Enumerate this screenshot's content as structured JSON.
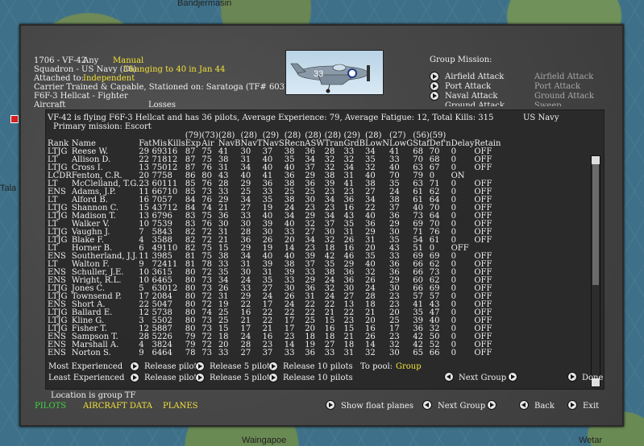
{
  "map": {
    "labels": [
      "Bandjermasin",
      "Waingapoe",
      "Wetar",
      "Tala"
    ]
  },
  "header": {
    "squadron_id": "1706 - VF-42",
    "any": "Any",
    "manual": "Manual",
    "squadron_line": "Squadron - US Navy (36)",
    "change_note": "Changing to 40 in Jan 44",
    "attached_label": "Attached to:",
    "attached_value": "Independent",
    "carrier_line": "Carrier Trained & Capable, Stationed on: Saratoga (TF# 603)",
    "aircraft_type": "F6F-3 Hellcat - Fighter",
    "aircraft_cut": "Aircraft",
    "losses_cut": "Losses",
    "plane_number": "33"
  },
  "group_mission": {
    "title": "Group Mission:",
    "options_left": [
      "Airfield Attack",
      "Port Attack",
      "Naval Attack",
      "Ground Attack"
    ],
    "options_right": [
      "Airfield Attack",
      "Port Attack",
      "Ground Attack",
      "Sweep"
    ]
  },
  "roster": {
    "summary": "VF-42 is flying F6F-3 Hellcat and has 36 pilots,  Average Experience: 79,  Average Fatigue: 12,  Total Kills: 315",
    "service": "US Navy",
    "primary_mission": "Primary mission: Escort",
    "averages": [
      "",
      "",
      "",
      "",
      "",
      "(79)",
      "(73)",
      "(28)",
      "(28)",
      "(29)",
      "(28)",
      "(28)",
      "(28)",
      "(29)",
      "(28)",
      "(27)",
      "(56)",
      "(59)",
      "",
      ""
    ],
    "headers": [
      "Rank",
      "Name",
      "Fat",
      "Mis",
      "Kills",
      "Exp",
      "Air",
      "NavB",
      "NavT",
      "NavS",
      "Recn",
      "ASW",
      "Tran",
      "GrdB",
      "LowN",
      "LowG",
      "Staf",
      "Def'n",
      "Delay",
      "Retain"
    ],
    "rows": [
      [
        "LTJG",
        "Reese W.",
        "29",
        "693",
        "16",
        "87",
        "75",
        "41",
        "30",
        "37",
        "38",
        "36",
        "28",
        "33",
        "34",
        "41",
        "68",
        "70",
        "0",
        "OFF"
      ],
      [
        "LT",
        "Allison D.",
        "22",
        "718",
        "12",
        "87",
        "75",
        "38",
        "31",
        "40",
        "35",
        "34",
        "32",
        "32",
        "35",
        "33",
        "70",
        "68",
        "0",
        "OFF"
      ],
      [
        "LTJG",
        "Cross I.",
        "13",
        "750",
        "12",
        "87",
        "76",
        "31",
        "34",
        "40",
        "40",
        "37",
        "32",
        "34",
        "32",
        "40",
        "63",
        "67",
        "0",
        "OFF"
      ],
      [
        "LCDR",
        "Fenton, C.R.",
        "20",
        "775",
        "8",
        "86",
        "80",
        "43",
        "40",
        "41",
        "36",
        "29",
        "38",
        "31",
        "40",
        "70",
        "79",
        "0",
        "ON",
        ""
      ],
      [
        "LT",
        "McClelland, T.G.",
        "23",
        "601",
        "11",
        "85",
        "76",
        "28",
        "29",
        "36",
        "38",
        "36",
        "39",
        "41",
        "38",
        "35",
        "63",
        "71",
        "0",
        "OFF"
      ],
      [
        "ENS",
        "Adams, J.P.",
        "11",
        "667",
        "10",
        "85",
        "73",
        "33",
        "25",
        "33",
        "25",
        "25",
        "23",
        "23",
        "27",
        "24",
        "61",
        "62",
        "0",
        "OFF"
      ],
      [
        "LT",
        "Alford B.",
        "16",
        "705",
        "7",
        "84",
        "76",
        "29",
        "34",
        "35",
        "38",
        "30",
        "34",
        "36",
        "34",
        "38",
        "61",
        "64",
        "0",
        "OFF"
      ],
      [
        "LTJG",
        "Shannon C.",
        "15",
        "437",
        "12",
        "84",
        "74",
        "21",
        "27",
        "19",
        "24",
        "23",
        "23",
        "16",
        "22",
        "37",
        "40",
        "70",
        "0",
        "OFF"
      ],
      [
        "LTJG",
        "Madison T.",
        "13",
        "679",
        "6",
        "83",
        "75",
        "36",
        "33",
        "40",
        "34",
        "29",
        "34",
        "43",
        "40",
        "36",
        "73",
        "64",
        "0",
        "OFF"
      ],
      [
        "LT",
        "Walker V.",
        "10",
        "753",
        "9",
        "83",
        "76",
        "30",
        "30",
        "39",
        "40",
        "32",
        "37",
        "35",
        "36",
        "29",
        "69",
        "70",
        "0",
        "OFF"
      ],
      [
        "LTJG",
        "Vaughn J.",
        "7",
        "584",
        "3",
        "82",
        "72",
        "31",
        "28",
        "30",
        "33",
        "27",
        "30",
        "31",
        "29",
        "30",
        "71",
        "76",
        "0",
        "OFF"
      ],
      [
        "LTJG",
        "Blake F.",
        "4",
        "358",
        "8",
        "82",
        "72",
        "21",
        "36",
        "26",
        "20",
        "34",
        "32",
        "26",
        "31",
        "35",
        "54",
        "61",
        "0",
        "OFF"
      ],
      [
        "LT",
        "Horner B.",
        "6",
        "491",
        "10",
        "82",
        "75",
        "15",
        "29",
        "19",
        "14",
        "23",
        "18",
        "16",
        "20",
        "43",
        "51",
        "0",
        "OFF",
        ""
      ],
      [
        "ENS",
        "Southerland, J.J.",
        "11",
        "398",
        "5",
        "81",
        "75",
        "38",
        "34",
        "40",
        "40",
        "39",
        "42",
        "46",
        "35",
        "33",
        "69",
        "69",
        "0",
        "OFF"
      ],
      [
        "LT",
        "Walton F.",
        "9",
        "724",
        "11",
        "81",
        "78",
        "33",
        "31",
        "39",
        "38",
        "37",
        "35",
        "29",
        "40",
        "36",
        "66",
        "62",
        "0",
        "OFF"
      ],
      [
        "ENS",
        "Schuller, J.E.",
        "10",
        "361",
        "5",
        "80",
        "72",
        "35",
        "30",
        "31",
        "39",
        "33",
        "38",
        "36",
        "32",
        "36",
        "66",
        "73",
        "0",
        "OFF"
      ],
      [
        "ENS",
        "Wright, R.L.",
        "10",
        "646",
        "5",
        "80",
        "73",
        "34",
        "24",
        "35",
        "33",
        "29",
        "24",
        "36",
        "26",
        "29",
        "60",
        "62",
        "0",
        "OFF"
      ],
      [
        "LTJG",
        "Jones C.",
        "5",
        "630",
        "12",
        "80",
        "73",
        "26",
        "33",
        "27",
        "30",
        "36",
        "32",
        "30",
        "24",
        "30",
        "66",
        "69",
        "0",
        "OFF"
      ],
      [
        "LTJG",
        "Townsend P.",
        "17",
        "208",
        "4",
        "80",
        "72",
        "31",
        "29",
        "24",
        "26",
        "31",
        "24",
        "27",
        "28",
        "23",
        "57",
        "57",
        "0",
        "OFF"
      ],
      [
        "ENS",
        "Short A.",
        "22",
        "504",
        "7",
        "80",
        "72",
        "19",
        "22",
        "17",
        "24",
        "22",
        "22",
        "13",
        "18",
        "23",
        "41",
        "43",
        "0",
        "OFF"
      ],
      [
        "LTJG",
        "Ballard E.",
        "12",
        "573",
        "8",
        "80",
        "74",
        "25",
        "16",
        "22",
        "22",
        "22",
        "21",
        "22",
        "21",
        "20",
        "35",
        "47",
        "0",
        "OFF"
      ],
      [
        "LTJG",
        "Kline G.",
        "3",
        "550",
        "2",
        "80",
        "73",
        "25",
        "21",
        "22",
        "17",
        "25",
        "15",
        "23",
        "20",
        "25",
        "39",
        "40",
        "0",
        "OFF"
      ],
      [
        "LTJG",
        "Fisher T.",
        "12",
        "588",
        "7",
        "80",
        "73",
        "15",
        "17",
        "21",
        "17",
        "20",
        "16",
        "15",
        "16",
        "17",
        "36",
        "32",
        "0",
        "OFF"
      ],
      [
        "ENS",
        "Sampson T.",
        "28",
        "522",
        "6",
        "79",
        "72",
        "18",
        "24",
        "16",
        "23",
        "18",
        "18",
        "21",
        "26",
        "23",
        "42",
        "50",
        "0",
        "OFF"
      ],
      [
        "ENS",
        "Marshall A.",
        "4",
        "382",
        "4",
        "79",
        "72",
        "20",
        "28",
        "23",
        "14",
        "19",
        "27",
        "18",
        "14",
        "32",
        "42",
        "52",
        "0",
        "OFF"
      ],
      [
        "ENS",
        "Norton S.",
        "9",
        "646",
        "4",
        "78",
        "73",
        "33",
        "27",
        "37",
        "33",
        "36",
        "33",
        "31",
        "32",
        "30",
        "65",
        "66",
        "0",
        "OFF"
      ]
    ]
  },
  "actions": {
    "most_experienced": "Most Experienced",
    "least_experienced": "Least Experienced",
    "release_pilot": "Release pilot",
    "release_5": "Release 5 pilots",
    "release_10": "Release 10 pilots",
    "to_pool": "To pool:",
    "pool_target": "Group",
    "next_group": "Next Group",
    "done": "Done"
  },
  "footer": {
    "location": "Location is group TF",
    "tabs": [
      "PILOTS",
      "AIRCRAFT DATA",
      "PLANES"
    ],
    "show_float": "Show float planes",
    "next_group": "Next Group",
    "back": "Back",
    "exit": "Exit"
  },
  "colors": {
    "name": "#f2e13a",
    "exp_high": "#ff9a2e",
    "rank_lcdr": "#ff3030",
    "active_tab": "#3fd63f"
  }
}
